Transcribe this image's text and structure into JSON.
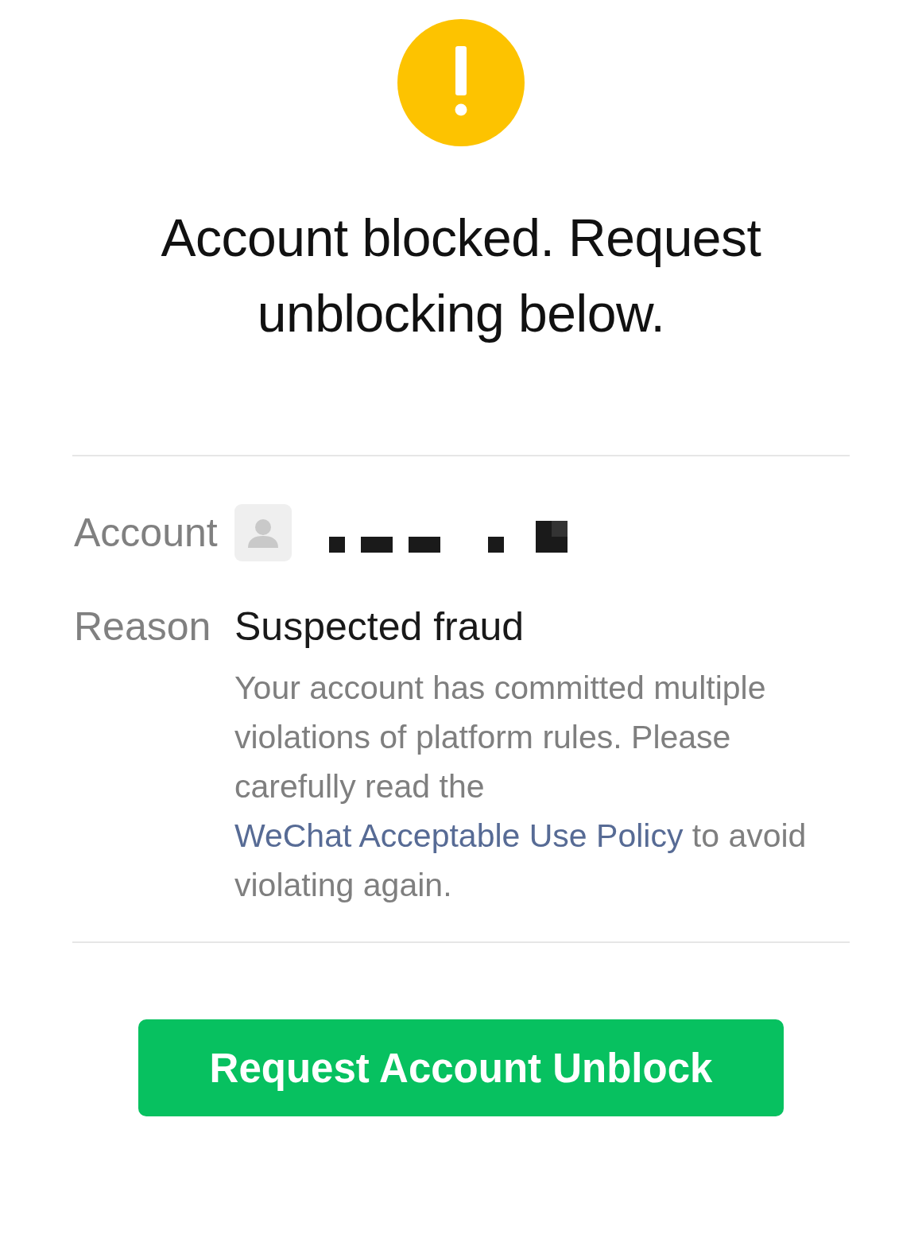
{
  "alert": {
    "kind": "warning"
  },
  "title": "Account blocked. Request unblocking below.",
  "details": [
    {
      "kind": "account",
      "label": "Account",
      "redacted": true
    },
    {
      "kind": "reason",
      "label": "Reason",
      "value": "Suspected fraud",
      "description": [
        {
          "kind": "text",
          "text": "Your account has committed multiple violations of platform rules. Please carefully read the "
        },
        {
          "kind": "link",
          "text": "WeChat Acceptable Use Policy"
        },
        {
          "kind": "text",
          "text": " to avoid violating again."
        }
      ]
    }
  ],
  "button": "Request Account Unblock"
}
